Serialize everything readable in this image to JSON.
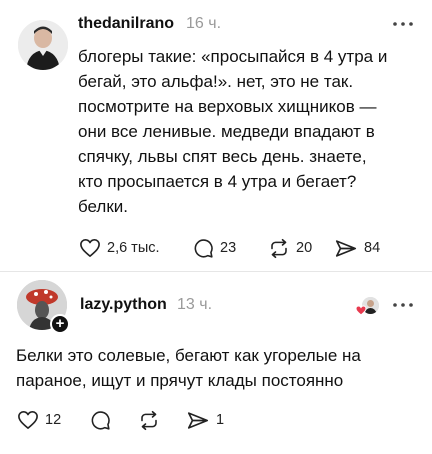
{
  "post1": {
    "username": "thedanilrano",
    "time": "16 ч.",
    "text": "блогеры такие: «просыпайся в 4 утра и\nбегай, это альфа!». нет, это не так.\nпосмотрите на верховых хищников —\nони все ленивые. медведи впадают в\nспячку, львы спят весь день. знаете,\nкто просыпается в 4 утра и бегает?\nбелки.",
    "likes": "2,6 тыс.",
    "comments": "23",
    "reposts": "20",
    "shares": "84"
  },
  "post2": {
    "username": "lazy.python",
    "time": "13 ч.",
    "text": "Белки это солевые, бегают как угорелые на\nпараное, ищут и прячут клады постоянно",
    "likes": "12",
    "shares": "1"
  },
  "icons": {
    "more": "more-horizontal-icon",
    "like": "heart-icon",
    "comment": "comment-bubble-icon",
    "repost": "repost-icon",
    "share": "send-icon"
  },
  "colors": {
    "accent_like": "#e83a4f",
    "muted": "#9a9a9a"
  }
}
